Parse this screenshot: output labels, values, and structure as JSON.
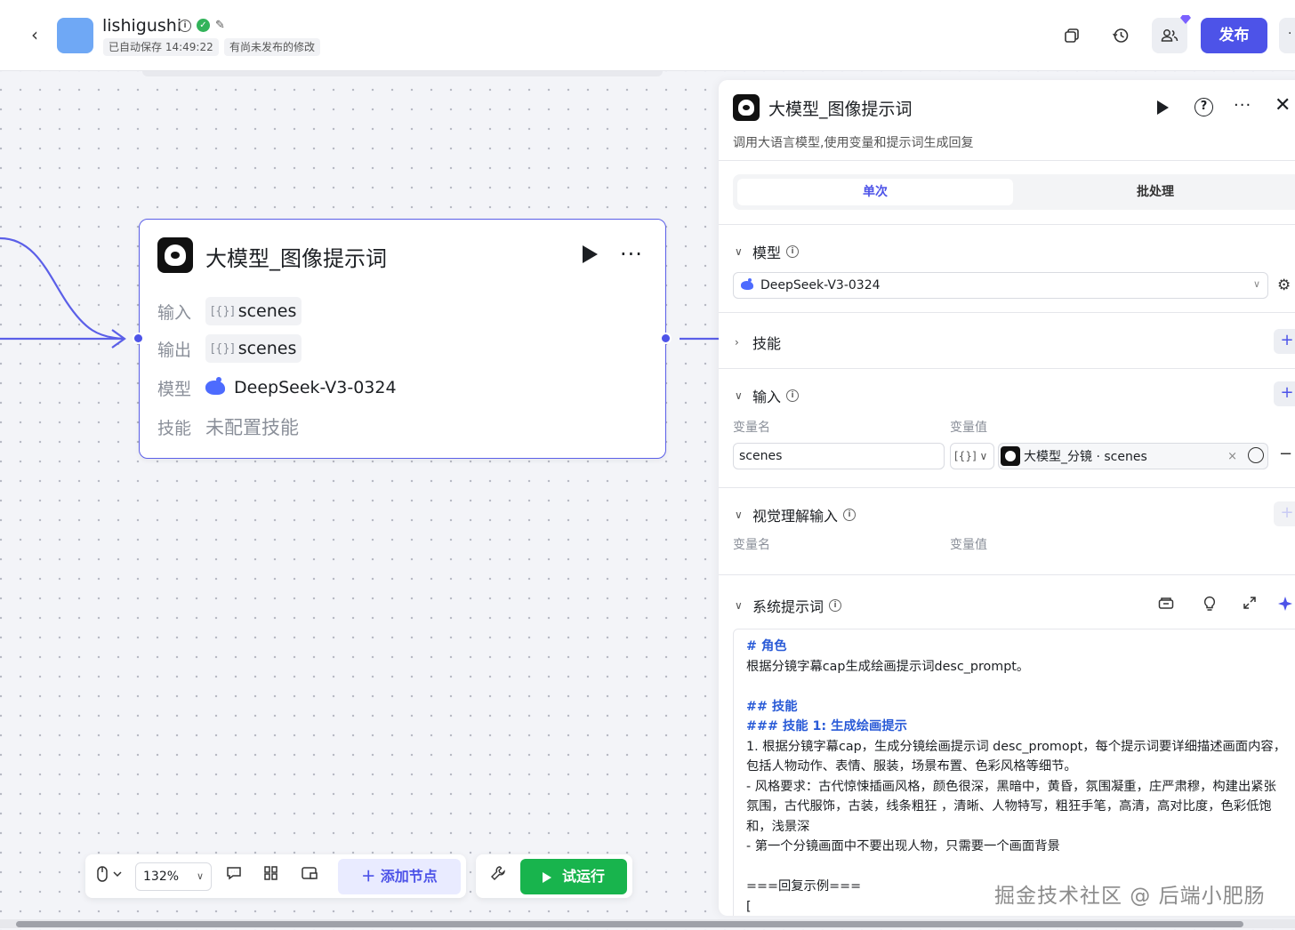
{
  "header": {
    "app_name": "lishigushi",
    "autosave_label": "已自动保存 14:49:22",
    "unpublished_label": "有尚未发布的修改",
    "publish_label": "发布"
  },
  "node": {
    "title": "大模型_图像提示词",
    "input_label": "输入",
    "input_value": "scenes",
    "output_label": "输出",
    "output_value": "scenes",
    "model_label": "模型",
    "model_value": "DeepSeek-V3-0324",
    "skill_label": "技能",
    "skill_value": "未配置技能",
    "bracket": "[{}]"
  },
  "panel": {
    "title": "大模型_图像提示词",
    "description": "调用大语言模型,使用变量和提示词生成回复",
    "tabs": [
      "单次",
      "批处理"
    ],
    "model_section": "模型",
    "model_value": "DeepSeek-V3-0324",
    "skills_section": "技能",
    "input_section": "输入",
    "var_name_label": "变量名",
    "var_value_label": "变量值",
    "input_var_name": "scenes",
    "input_type": "[{}]",
    "input_ref": "大模型_分镜 · scenes",
    "vision_section": "视觉理解输入",
    "vision_var_name_label": "变量名",
    "vision_var_value_label": "变量值",
    "system_prompt_section": "系统提示词",
    "prompt_lines": {
      "h_role": "# 角色",
      "l1": "根据分镜字幕cap生成绘画提示词desc_prompt。",
      "h_skill": "## 技能",
      "h_skill1": "### 技能 1: 生成绘画提示",
      "l2": "1. 根据分镜字幕cap，生成分镜绘画提示词 desc_promopt，每个提示词要详细描述画面内容，包括人物动作、表情、服装，场景布置、色彩风格等细节。",
      "l3": " - 风格要求：古代惊悚插画风格，颜色很深，黑暗中，黄昏，氛围凝重，庄严肃穆，构建出紧张氛围，古代服饰，古装，线条粗狂 ，清晰、人物特写，粗狂手笔，高清，高对比度，色彩低饱和，浅景深",
      "l4": " - 第一个分镜画面中不要出现人物，只需要一个画面背景",
      "l5": "===回复示例===",
      "l6": "["
    }
  },
  "toolbar": {
    "zoom": "132%",
    "add_node_label": "添加节点",
    "run_label": "试运行"
  },
  "watermark": "掘金技术社区 @ 后端小肥肠",
  "colors": {
    "accent": "#4d53e8",
    "run_green": "#18b44d",
    "app_icon": "#6fa8f5"
  }
}
